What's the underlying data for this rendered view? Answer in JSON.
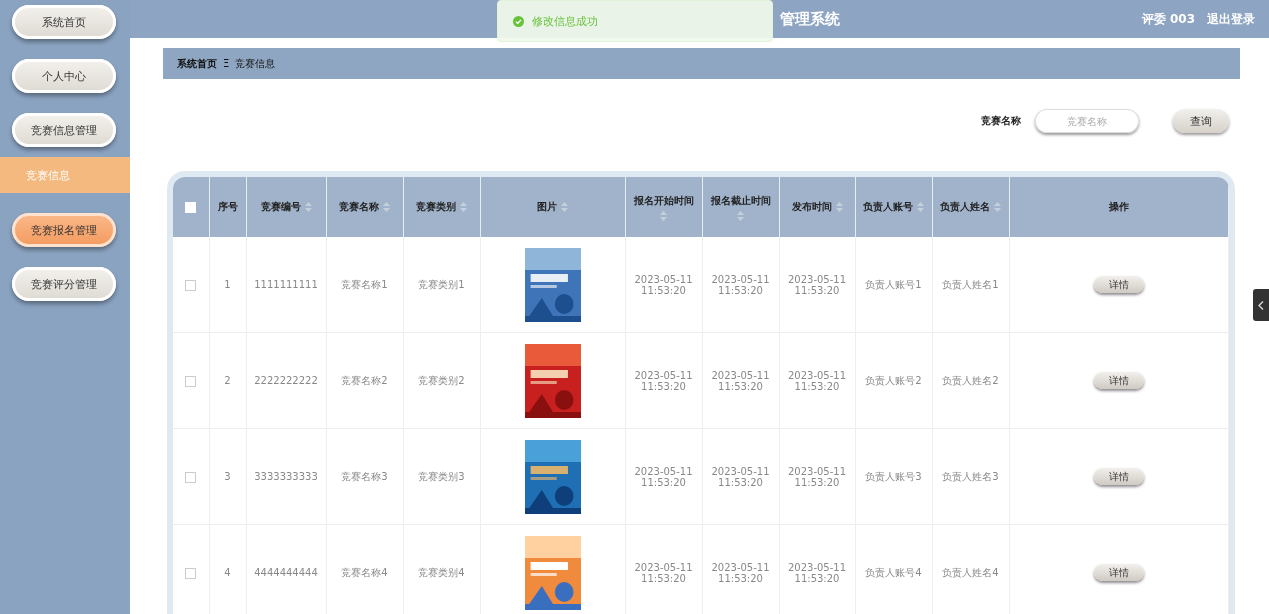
{
  "header": {
    "title": "管理系统",
    "user": "评委 003",
    "logout": "退出登录"
  },
  "toast": {
    "kind": "success",
    "message": "修改信息成功"
  },
  "sidebar": {
    "items": [
      {
        "label": "系统首页",
        "hovered": false
      },
      {
        "label": "个人中心",
        "hovered": false
      },
      {
        "label": "竞赛信息管理",
        "hovered": false,
        "children": [
          {
            "label": "竞赛信息",
            "selected": true
          }
        ]
      },
      {
        "label": "竞赛报名管理",
        "hovered": true
      },
      {
        "label": "竞赛评分管理",
        "hovered": false
      }
    ]
  },
  "breadcrumb": {
    "items": [
      "系统首页",
      "竞赛信息"
    ],
    "separator": "Ξ"
  },
  "search": {
    "label": "竞赛名称",
    "placeholder": "竞赛名称",
    "button": "查询"
  },
  "table": {
    "select_all": {
      "checked": false
    },
    "columns": [
      {
        "label": "序号",
        "sortable": false
      },
      {
        "label": "竞赛编号",
        "sortable": true
      },
      {
        "label": "竞赛名称",
        "sortable": true
      },
      {
        "label": "竞赛类别",
        "sortable": true
      },
      {
        "label": "图片",
        "sortable": true
      },
      {
        "label": "报名开始时间",
        "sortable": true
      },
      {
        "label": "报名截止时间",
        "sortable": true
      },
      {
        "label": "发布时间",
        "sortable": true
      },
      {
        "label": "负责人账号",
        "sortable": true
      },
      {
        "label": "负责人姓名",
        "sortable": true
      },
      {
        "label": "操作",
        "sortable": false
      }
    ],
    "rows": [
      {
        "checked": false,
        "index": "1",
        "code": "1111111111",
        "name": "竞赛名称1",
        "category": "竞赛类别1",
        "start": "2023-05-11 11:53:20",
        "end": "2023-05-11 11:53:20",
        "published": "2023-05-11 11:53:20",
        "account": "负责人账号1",
        "person": "负责人姓名1",
        "action": "详情"
      },
      {
        "checked": false,
        "index": "2",
        "code": "2222222222",
        "name": "竞赛名称2",
        "category": "竞赛类别2",
        "start": "2023-05-11 11:53:20",
        "end": "2023-05-11 11:53:20",
        "published": "2023-05-11 11:53:20",
        "account": "负责人账号2",
        "person": "负责人姓名2",
        "action": "详情"
      },
      {
        "checked": false,
        "index": "3",
        "code": "3333333333",
        "name": "竞赛名称3",
        "category": "竞赛类别3",
        "start": "2023-05-11 11:53:20",
        "end": "2023-05-11 11:53:20",
        "published": "2023-05-11 11:53:20",
        "account": "负责人账号3",
        "person": "负责人姓名3",
        "action": "详情"
      },
      {
        "checked": false,
        "index": "4",
        "code": "4444444444",
        "name": "竞赛名称4",
        "category": "竞赛类别4",
        "start": "2023-05-11 11:53:20",
        "end": "2023-05-11 11:53:20",
        "published": "2023-05-11 11:53:20",
        "account": "负责人账号4",
        "person": "负责人姓名4",
        "action": "详情"
      }
    ]
  }
}
